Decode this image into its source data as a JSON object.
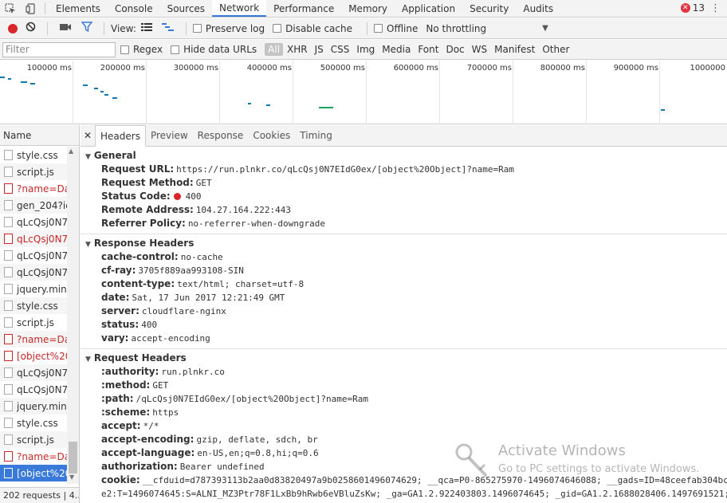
{
  "tabbar": {
    "tabs": [
      "Elements",
      "Console",
      "Sources",
      "Network",
      "Performance",
      "Memory",
      "Application",
      "Security",
      "Audits"
    ],
    "active": "Network",
    "error_count": "13"
  },
  "toolbar": {
    "view_label": "View:",
    "preserve_log": "Preserve log",
    "disable_cache": "Disable cache",
    "offline": "Offline",
    "throttling": "No throttling"
  },
  "filterbar": {
    "placeholder": "Filter",
    "regex": "Regex",
    "hide_data_urls": "Hide data URLs",
    "types": [
      "All",
      "XHR",
      "JS",
      "CSS",
      "Img",
      "Media",
      "Font",
      "Doc",
      "WS",
      "Manifest",
      "Other"
    ]
  },
  "overview": {
    "ticks": [
      "100000 ms",
      "200000 ms",
      "300000 ms",
      "400000 ms",
      "500000 ms",
      "600000 ms",
      "700000 ms",
      "800000 ms",
      "900000 ms",
      "1000000"
    ]
  },
  "reqlist": {
    "header": "Name",
    "rows": [
      {
        "name": "style.css",
        "err": false
      },
      {
        "name": "script.js",
        "err": false
      },
      {
        "name": "?name=Dar",
        "err": true
      },
      {
        "name": "gen_204?id",
        "err": false
      },
      {
        "name": "qLcQsj0N7E",
        "err": false
      },
      {
        "name": "qLcQsj0N7E",
        "err": true
      },
      {
        "name": "qLcQsj0N7E",
        "err": false
      },
      {
        "name": "qLcQsj0N7E",
        "err": false
      },
      {
        "name": "jquery.min.j",
        "err": false
      },
      {
        "name": "style.css",
        "err": false
      },
      {
        "name": "script.js",
        "err": false
      },
      {
        "name": "?name=Dar",
        "err": true
      },
      {
        "name": "[object%20",
        "err": true
      },
      {
        "name": "qLcQsj0N7E",
        "err": false
      },
      {
        "name": "qLcQsj0N7E",
        "err": false
      },
      {
        "name": "jquery.min.j",
        "err": false
      },
      {
        "name": "style.css",
        "err": false
      },
      {
        "name": "script.js",
        "err": false
      },
      {
        "name": "?name=Dar",
        "err": true
      },
      {
        "name": "[object%20",
        "err": false,
        "selected": true
      }
    ],
    "status": "202 requests | 4..."
  },
  "details": {
    "tabs": [
      "Headers",
      "Preview",
      "Response",
      "Cookies",
      "Timing"
    ],
    "active": "Headers",
    "general": {
      "title": "General",
      "request_url_k": "Request URL:",
      "request_url_v": "https://run.plnkr.co/qLcQsj0N7EIdG0ex/[object%20Object]?name=Ram",
      "request_method_k": "Request Method:",
      "request_method_v": "GET",
      "status_code_k": "Status Code:",
      "status_code_v": "400",
      "remote_address_k": "Remote Address:",
      "remote_address_v": "104.27.164.222:443",
      "referrer_policy_k": "Referrer Policy:",
      "referrer_policy_v": "no-referrer-when-downgrade"
    },
    "response_headers": {
      "title": "Response Headers",
      "items": [
        {
          "k": "cache-control:",
          "v": "no-cache"
        },
        {
          "k": "cf-ray:",
          "v": "3705f889aa993108-SIN"
        },
        {
          "k": "content-type:",
          "v": "text/html; charset=utf-8"
        },
        {
          "k": "date:",
          "v": "Sat, 17 Jun 2017 12:21:49 GMT"
        },
        {
          "k": "server:",
          "v": "cloudflare-nginx"
        },
        {
          "k": "status:",
          "v": "400"
        },
        {
          "k": "vary:",
          "v": "accept-encoding"
        }
      ]
    },
    "request_headers": {
      "title": "Request Headers",
      "items": [
        {
          "k": ":authority:",
          "v": "run.plnkr.co"
        },
        {
          "k": ":method:",
          "v": "GET"
        },
        {
          "k": ":path:",
          "v": "/qLcQsj0N7EIdG0ex/[object%20Object]?name=Ram"
        },
        {
          "k": ":scheme:",
          "v": "https"
        },
        {
          "k": "accept:",
          "v": "*/*"
        },
        {
          "k": "accept-encoding:",
          "v": "gzip, deflate, sdch, br"
        },
        {
          "k": "accept-language:",
          "v": "en-US,en;q=0.8,hi;q=0.6"
        },
        {
          "k": "authorization:",
          "v": "Bearer undefined"
        },
        {
          "k": "cookie:",
          "v": "__cfduid=d787393113b2aa0d83820497a9b0258601496074629; __qca=P0-865275970-1496074646088; __gads=ID=48ceefab304bc1"
        }
      ],
      "cookie_cont": "e2:T=1496074645:S=ALNI_MZ3Ptr78F1LxBb9hRwb6eVBluZsKw; _ga=GA1.2.922403803.1496074645; _gid=GA1.2.1688028406.1497691521;"
    }
  },
  "watermark": {
    "title": "Activate Windows",
    "subtitle": "Go to PC settings to activate Windows."
  }
}
